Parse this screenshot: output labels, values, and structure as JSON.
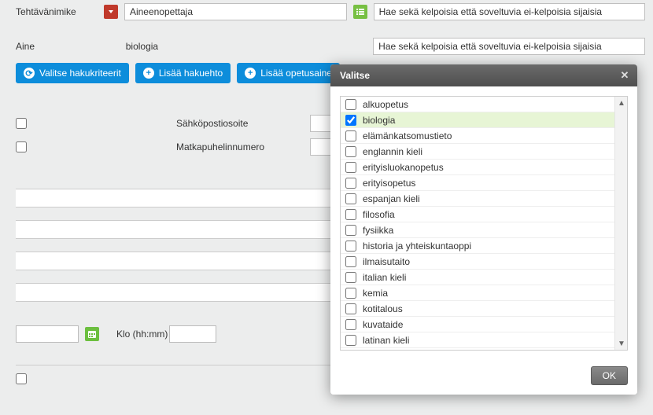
{
  "form": {
    "title_label": "Tehtävänimike",
    "title_value": "Aineenopettaja",
    "title_criteria": "Hae sekä kelpoisia että soveltuvia ei-kelpoisia sijaisia",
    "subject_label": "Aine",
    "subject_value": "biologia",
    "subject_criteria": "Hae sekä kelpoisia että soveltuvia ei-kelpoisia sijaisia",
    "email_label": "Sähköpostiosoite",
    "phone_label": "Matkapuhelinnumero",
    "klo_label": "Klo (hh:mm)"
  },
  "buttons": {
    "select_criteria": "Valitse hakukriteerit",
    "add_criteria": "Lisää hakuehto",
    "add_subject": "Lisää opetusaine"
  },
  "modal": {
    "title": "Valitse",
    "ok": "OK",
    "items": [
      {
        "label": "alkuopetus",
        "checked": false
      },
      {
        "label": "biologia",
        "checked": true
      },
      {
        "label": "elämänkatsomustieto",
        "checked": false
      },
      {
        "label": "englannin kieli",
        "checked": false
      },
      {
        "label": "erityisluokanopetus",
        "checked": false
      },
      {
        "label": "erityisopetus",
        "checked": false
      },
      {
        "label": "espanjan kieli",
        "checked": false
      },
      {
        "label": "filosofia",
        "checked": false
      },
      {
        "label": "fysiikka",
        "checked": false
      },
      {
        "label": "historia ja yhteiskuntaoppi",
        "checked": false
      },
      {
        "label": "ilmaisutaito",
        "checked": false
      },
      {
        "label": "italian kieli",
        "checked": false
      },
      {
        "label": "kemia",
        "checked": false
      },
      {
        "label": "kotitalous",
        "checked": false
      },
      {
        "label": "kuvataide",
        "checked": false
      },
      {
        "label": "latinan kieli",
        "checked": false
      }
    ]
  }
}
